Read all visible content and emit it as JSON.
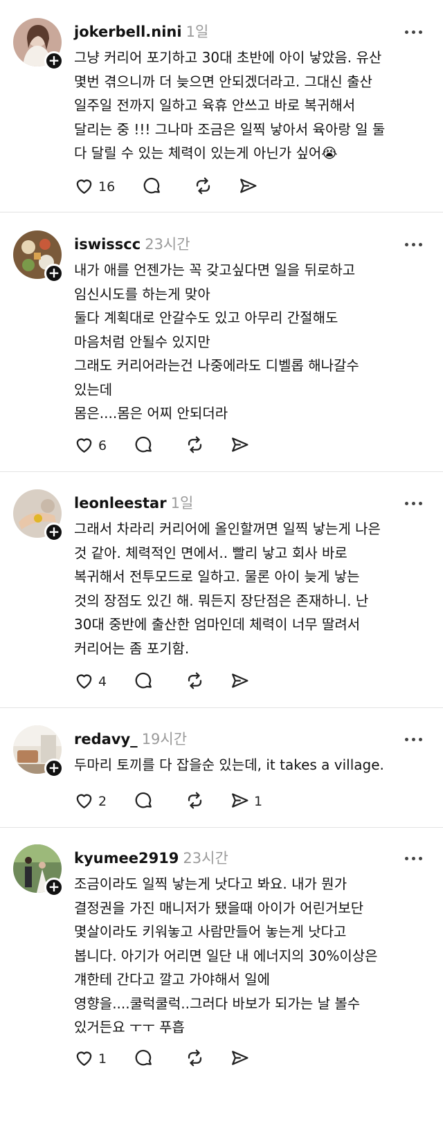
{
  "comments": [
    {
      "username": "jokerbell.nini",
      "time": "1일",
      "text": "그냥 커리어 포기하고 30대 초반에 아이 낳았음. 유산\n몇번 겪으니까 더 늦으면 안되겠더라고. 그대신 출산\n일주일 전까지 일하고 육휴 안쓰고 바로 복귀해서\n달리는 중 !!! 그나마 조금은 일찍 낳아서 육아랑 일 둘\n다 달릴 수 있는 체력이 있는게 아닌가 싶어😭",
      "likes": "16",
      "shares": "",
      "avatar_color": "#c9a89a",
      "avatar_icon": "woman-portrait-avatar"
    },
    {
      "username": "iswisscc",
      "time": "23시간",
      "text": "내가 애를 언젠가는 꼭 갖고싶다면 일을 뒤로하고\n임신시도를 하는게 맞아\n둘다 계획대로 안갈수도 있고 아무리 간절해도\n마음처럼 안될수 있지만\n그래도 커리어라는건 나중에라도 디벨롭 해나갈수\n있는데\n몸은....몸은 어찌 안되더라",
      "likes": "6",
      "shares": "",
      "avatar_color": "#7a5a3a",
      "avatar_icon": "food-table-avatar"
    },
    {
      "username": "leonleestar",
      "time": "1일",
      "text": "그래서 차라리 커리어에 올인할꺼면 일찍 낳는게 나은\n것 같아. 체력적인 면에서.. 빨리 낳고 회사 바로\n복귀해서 전투모드로 일하고. 물론 아이 늦게 낳는\n것의 장점도 있긴 해. 뭐든지 장단점은 존재하니. 난\n30대 중반에 출산한 엄마인데 체력이 너무 딸려서\n커리어는 좀 포기함.",
      "likes": "4",
      "shares": "",
      "avatar_color": "#d9cfc4",
      "avatar_icon": "hand-ring-avatar"
    },
    {
      "username": "redavy_",
      "time": "19시간",
      "text": "두마리 토끼를 다 잡을순 있는데, it takes a village.",
      "likes": "2",
      "shares": "1",
      "avatar_color": "#b8a58c",
      "avatar_icon": "interior-room-avatar"
    },
    {
      "username": "kyumee2919",
      "time": "23시간",
      "text": "조금이라도 일찍 낳는게 낫다고 봐요. 내가 뭔가\n결정권을 가진 매니저가 됐을때 아이가 어린거보단\n몇살이라도 키워놓고 사람만들어 놓는게 낫다고\n봅니다. 아기가 어리면 일단 내 에너지의 30%이상은\n걔한테 간다고 깔고 가야해서 일에\n영향을....쿨럭쿨럭..그러다 바보가 되가는 날 볼수\n있거든요 ㅜㅜ 푸흡",
      "likes": "1",
      "shares": "",
      "avatar_color": "#6f8a5a",
      "avatar_icon": "couple-garden-avatar"
    }
  ],
  "icons": {
    "like": "heart-icon",
    "reply": "comment-bubble-icon",
    "repost": "repost-icon",
    "share": "send-icon",
    "more": "more-dots-icon",
    "follow": "plus-icon"
  },
  "colors": {
    "text": "#111111",
    "muted": "#9a9a9a",
    "divider": "#e3e3e3"
  }
}
